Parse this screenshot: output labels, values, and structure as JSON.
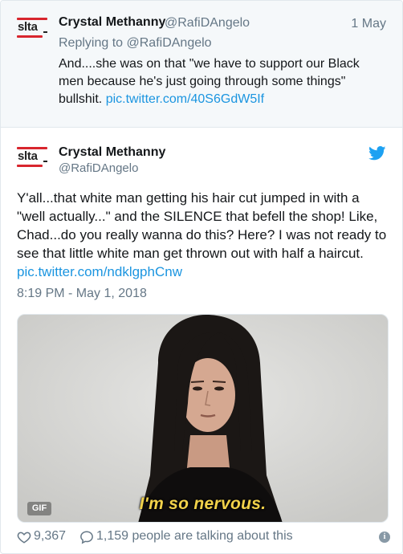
{
  "parent_tweet": {
    "avatar_text": "slta",
    "name": "Crystal Methanny",
    "handle": "@RafiDAngelo",
    "date": "1 May",
    "replying_label": "Replying to",
    "replying_to": "@RafiDAngelo",
    "text": "And....she was on that \"we have to support our Black men because he's just going through some things\" bullshit.",
    "link": "pic.twitter.com/40S6GdW5If"
  },
  "main_tweet": {
    "avatar_text": "slta",
    "name": "Crystal Methanny",
    "handle": "@RafiDAngelo",
    "icon": "twitter-bird-icon",
    "text": "Y'all...that white man getting his hair cut jumped in with a \"well actually...\" and the SILENCE that befell the shop! Like, Chad...do you really wanna do this? Here? I was not ready to see that little white man get thrown out with half a haircut.",
    "link": "pic.twitter.com/ndklgphCnw",
    "timestamp": "8:19 PM - May 1, 2018"
  },
  "media": {
    "badge": "GIF",
    "caption": "I'm so nervous."
  },
  "footer": {
    "likes": "9,367",
    "talking": "1,159 people are talking about this",
    "info_icon": "info-icon"
  },
  "colors": {
    "link": "#1b95e0",
    "muted": "#657786",
    "avatar_red": "#d8262e",
    "twitter_blue": "#1da1f2"
  }
}
